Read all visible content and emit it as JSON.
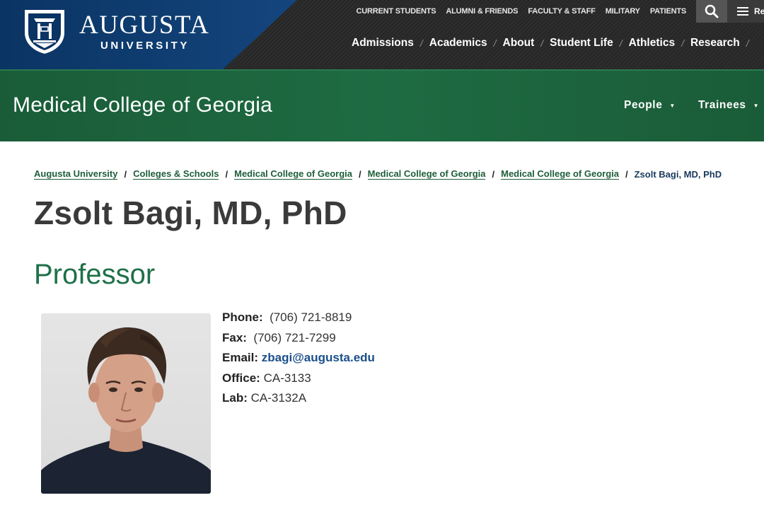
{
  "brand": {
    "name_line1": "AUGUSTA",
    "name_line2": "UNIVERSITY",
    "navy": "#0a3463"
  },
  "utility_nav": [
    "CURRENT STUDENTS",
    "ALUMNI & FRIENDS",
    "FACULTY & STAFF",
    "MILITARY",
    "PATIENTS"
  ],
  "header_tools": {
    "search_icon": "search-icon",
    "menu_icon": "hamburger-icon",
    "menu_label": "Re"
  },
  "main_nav": [
    "Admissions",
    "Academics",
    "About",
    "Student Life",
    "Athletics",
    "Research"
  ],
  "main_nav_separator": "/",
  "college": {
    "title": "Medical College of Georgia",
    "green": "#1e6b42",
    "nav": [
      {
        "label": "People"
      },
      {
        "label": "Trainees"
      }
    ]
  },
  "breadcrumb": {
    "separator": "/",
    "links": [
      "Augusta University",
      "Colleges & Schools",
      "Medical College of Georgia",
      "Medical College of Georgia",
      "Medical College of Georgia"
    ],
    "current": "Zsolt Bagi, MD, PhD"
  },
  "profile": {
    "name": "Zsolt Bagi, MD, PhD",
    "title": "Professor",
    "contact": {
      "phone_label": "Phone:",
      "phone": "(706) 721-8819",
      "fax_label": "Fax:",
      "fax": "(706) 721-7299",
      "email_label": "Email:",
      "email": "zbagi@augusta.edu",
      "office_label": "Office:",
      "office": "CA-3133",
      "lab_label": "Lab:",
      "lab": "CA-3132A"
    }
  }
}
